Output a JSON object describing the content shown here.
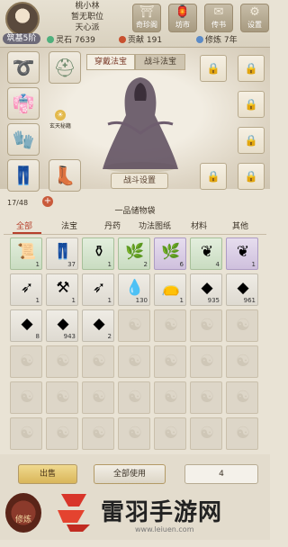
{
  "header": {
    "player_name": "桃小林",
    "position": "暂无职位",
    "sect": "天心派",
    "realm": "筑基5阶",
    "stats": {
      "spirit_stone_label": "灵石",
      "spirit_stone": "7639",
      "contribution_label": "贡献",
      "contribution": "191",
      "cultivation_label": "修炼",
      "cultivation": "7年"
    },
    "buttons": [
      {
        "label": "奇珍阁",
        "icon": "pavilion-icon",
        "glyph": "⛩"
      },
      {
        "label": "坊市",
        "icon": "market-icon",
        "glyph": "🏮"
      },
      {
        "label": "传书",
        "icon": "scroll-letter-icon",
        "glyph": "✉"
      },
      {
        "label": "设置",
        "icon": "gear-icon",
        "glyph": "⚙"
      }
    ]
  },
  "equipment": {
    "tabs": [
      "穿戴法宝",
      "战斗法宝"
    ],
    "active_tab": "穿戴法宝",
    "buff_label": "玄天秘籍",
    "fight_setting_label": "战斗设置",
    "lock_icon": "lock-icon"
  },
  "storage": {
    "capacity": "17/48",
    "title": "一品储物袋",
    "categories": [
      "全部",
      "法宝",
      "丹药",
      "功法图纸",
      "材料",
      "其他"
    ],
    "active_category": "全部"
  },
  "inventory": [
    {
      "icon": "scroll-book-icon",
      "glyph": "📜",
      "count": "1",
      "rarity": "green"
    },
    {
      "icon": "pants-icon",
      "glyph": "👖",
      "count": "37",
      "rarity": "gray"
    },
    {
      "icon": "vase-icon",
      "glyph": "⚱",
      "count": "1",
      "rarity": "green"
    },
    {
      "icon": "herb-icon",
      "glyph": "🌿",
      "count": "2",
      "rarity": "green"
    },
    {
      "icon": "herb-icon",
      "glyph": "🌿",
      "count": "6",
      "rarity": "purple"
    },
    {
      "icon": "vine-icon",
      "glyph": "❦",
      "count": "4",
      "rarity": "green"
    },
    {
      "icon": "vine-icon",
      "glyph": "❦",
      "count": "1",
      "rarity": "purple"
    },
    {
      "icon": "bow-icon",
      "glyph": "➶",
      "count": "1",
      "rarity": "gray"
    },
    {
      "icon": "hammer-icon",
      "glyph": "⚒",
      "count": "1",
      "rarity": "gray"
    },
    {
      "icon": "bow-icon",
      "glyph": "➶",
      "count": "1",
      "rarity": "gray"
    },
    {
      "icon": "water-drop-icon",
      "glyph": "💧",
      "count": "130",
      "rarity": "gray"
    },
    {
      "icon": "talisman-bag-icon",
      "glyph": "👝",
      "count": "1",
      "rarity": "gray"
    },
    {
      "icon": "stone-icon",
      "glyph": "◆",
      "count": "935",
      "rarity": "gray"
    },
    {
      "icon": "gold-ore-icon",
      "glyph": "◆",
      "count": "961",
      "rarity": "gray"
    },
    {
      "icon": "iron-ore-icon",
      "glyph": "◆",
      "count": "8",
      "rarity": "gray"
    },
    {
      "icon": "copper-ore-icon",
      "glyph": "◆",
      "count": "943",
      "rarity": "gray"
    },
    {
      "icon": "crystal-ore-icon",
      "glyph": "◆",
      "count": "2",
      "rarity": "gray"
    }
  ],
  "actions": {
    "sell": "出售",
    "use_all": "全部使用",
    "quantity": "4",
    "refine": "修炼"
  },
  "watermark": {
    "text": "雷羽手游网",
    "url": "www.leiuen.com"
  }
}
